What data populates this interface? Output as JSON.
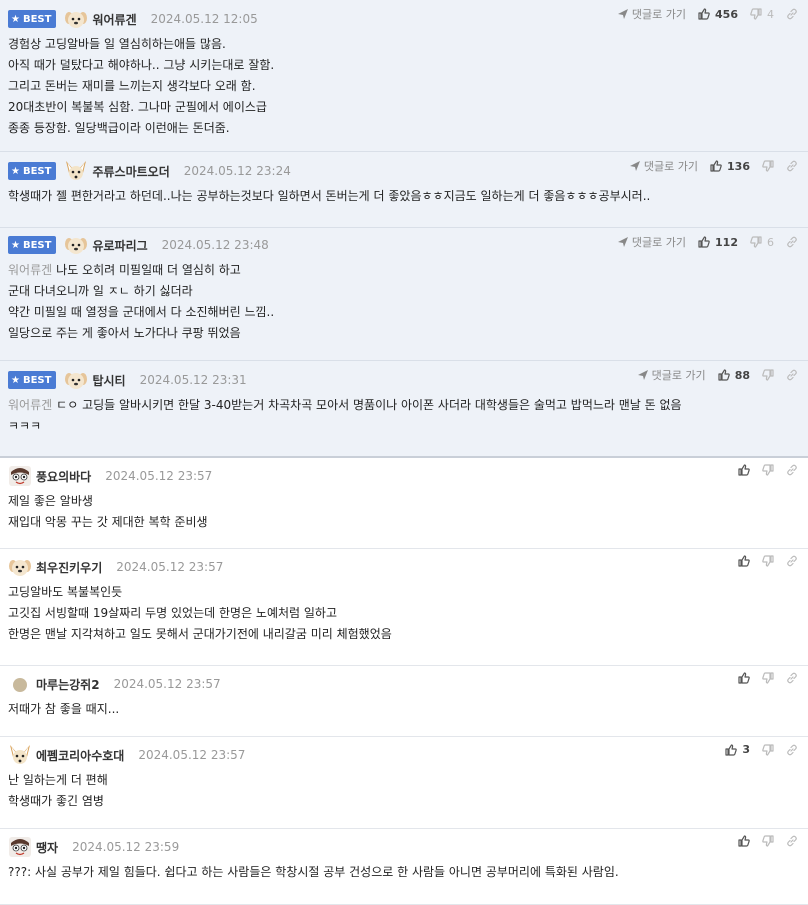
{
  "labels": {
    "best": "BEST",
    "reply": "댓글로 가기"
  },
  "colors": {
    "best_badge": "#4a7bd4",
    "best_background": "#eef2f8",
    "mention": "#999999"
  },
  "comments": [
    {
      "best": true,
      "avatar": "puppy-icon",
      "nick": "워어류겐",
      "date": "2024.05.12 12:05",
      "likes": "456",
      "dislikes": "4",
      "mention": "",
      "lines": [
        "경험상 고딩알바들 일 열심히하는애들 많음.",
        "아직 때가 덜탔다고 해야하나.. 그냥 시키는대로 잘함.",
        "그리고 돈버는 재미를 느끼는지 생각보다 오래 함.",
        "20대초반이 복불복 심함. 그나마 군필에서 에이스급",
        "종종 등장함. 일당백급이라 이런애는 돈더줌."
      ]
    },
    {
      "best": true,
      "avatar": "fennec-fox-icon",
      "nick": "주류스마트오더",
      "date": "2024.05.12 23:24",
      "likes": "136",
      "dislikes": "",
      "mention": "",
      "lines": [
        "학생때가 젤 편한거라고 하던데..나는 공부하는것보다 일하면서 돈버는게 더 좋았음ㅎㅎ지금도 일하는게 더 좋음ㅎㅎㅎ공부시러.."
      ]
    },
    {
      "best": true,
      "avatar": "puppy-icon",
      "nick": "유로파리그",
      "date": "2024.05.12 23:48",
      "likes": "112",
      "dislikes": "6",
      "mention": "워어류겐",
      "lines": [
        "나도 오히려 미필일때 더 열심히 하고",
        "군대 다녀오니까 일 ㅈㄴ 하기 싫더라",
        "약간 미필일 때 열정을 군대에서 다 소진해버린 느낌..",
        "일당으로 주는 게 좋아서 노가다나 쿠팡 뛰었음"
      ]
    },
    {
      "best": true,
      "avatar": "puppy-icon",
      "nick": "탑시티",
      "date": "2024.05.12 23:31",
      "likes": "88",
      "dislikes": "",
      "mention": "워어류겐",
      "lines": [
        "ㄷㅇ 고딩들 알바시키면 한달 3-40받는거 차곡차곡 모아서 명품이나 아이폰 사더라 대학생들은 술먹고 밥먹느라 맨날 돈 없음",
        "ㅋㅋㅋ"
      ]
    },
    {
      "best": false,
      "avatar": "cartoon-face-icon",
      "nick": "풍요의바다",
      "date": "2024.05.12 23:57",
      "likes": "",
      "dislikes": "",
      "mention": "",
      "lines": [
        "제일 좋은 알바생",
        "재입대 악몽 꾸는 갓 제대한 복학 준비생"
      ]
    },
    {
      "best": false,
      "avatar": "puppy-icon",
      "nick": "최우진키우기",
      "date": "2024.05.12 23:57",
      "likes": "",
      "dislikes": "",
      "mention": "",
      "lines": [
        "고딩알바도 복불복인듯",
        "고깃집 서빙할때 19살짜리 두명 있었는데 한명은 노예처럼 일하고",
        "한명은 맨날 지각쳐하고 일도 못해서 군대가기전에 내리갈굼 미리 체험했었음"
      ]
    },
    {
      "best": false,
      "avatar": "default-avatar-icon",
      "nick": "마루는강쥐2",
      "date": "2024.05.12 23:57",
      "likes": "",
      "dislikes": "",
      "mention": "",
      "lines": [
        "저때가 참 좋을 때지..."
      ]
    },
    {
      "best": false,
      "avatar": "fennec-fox-icon",
      "nick": "에펨코리아수호대",
      "date": "2024.05.12 23:57",
      "likes": "3",
      "dislikes": "",
      "mention": "",
      "lines": [
        "난 일하는게 더 편해",
        "학생때가 좋긴 염병"
      ]
    },
    {
      "best": false,
      "avatar": "cartoon-face-icon",
      "nick": "땡자",
      "date": "2024.05.12 23:59",
      "likes": "",
      "dislikes": "",
      "mention": "",
      "lines": [
        "???: 사실 공부가 제일 힘들다. 쉽다고 하는 사람들은 학창시절 공부 건성으로 한 사람들 아니면 공부머리에 특화된 사람임."
      ]
    }
  ]
}
